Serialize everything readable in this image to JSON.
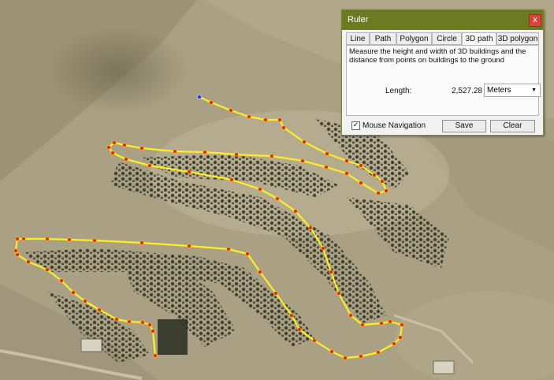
{
  "ruler": {
    "title": "Ruler",
    "close_glyph": "x",
    "tabs": [
      "Line",
      "Path",
      "Polygon",
      "Circle",
      "3D path",
      "3D polygon"
    ],
    "active_tab": "3D path",
    "description": "Measure the height and width of 3D buildings and the distance from points on buildings to the ground",
    "length_label": "Length:",
    "length_value": "2,527.28",
    "unit": "Meters",
    "mouse_nav_label": "Mouse Navigation",
    "mouse_nav_checked": true,
    "save_label": "Save",
    "clear_label": "Clear"
  },
  "colors": {
    "titlebar": "#6c7b22",
    "path_line": "#ffee22",
    "path_point": "#e02a1a",
    "start_point": "#2240e0"
  }
}
